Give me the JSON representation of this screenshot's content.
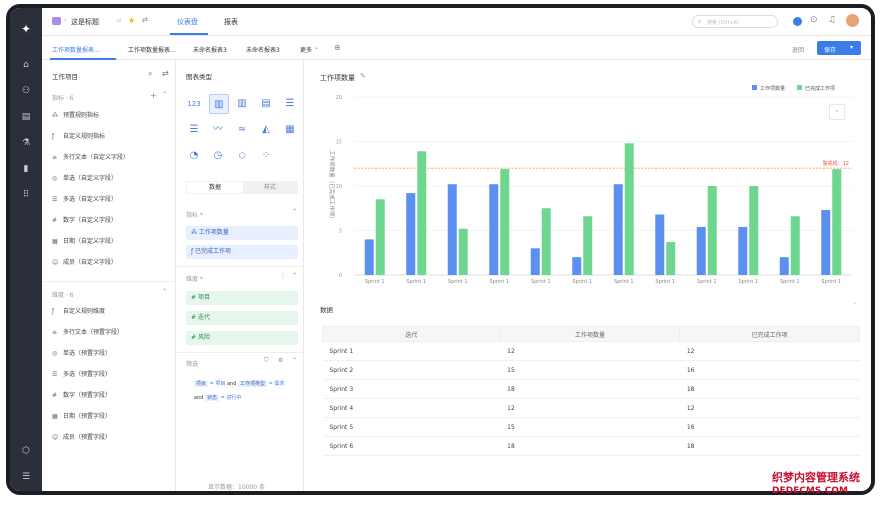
{
  "topbar": {
    "breadcrumb": "这是标题",
    "tabs": [
      "仪表盘",
      "报表"
    ],
    "search_placeholder": "搜索 (Ctrl+K)"
  },
  "report_tabs": {
    "items": [
      "工作项数量报表...",
      "工作项数量报表...",
      "未命名报表3",
      "未命名报表3",
      "更多"
    ],
    "cancel": "退回",
    "save": "保存"
  },
  "fields_panel": {
    "title": "工作项目",
    "metrics_header": "指标 · 6",
    "metrics": [
      "预置规则指标",
      "自定义规则指标",
      "多行文本（自定义字段）",
      "单选（自定义字段）",
      "多选（自定义字段）",
      "数字（自定义字段）",
      "日期（自定义字段）",
      "成员（自定义字段）"
    ],
    "dims_header": "维度 · 6",
    "dims": [
      "自定义规则维度",
      "多行文本（预置字段）",
      "单选（预置字段）",
      "多选（预置字段）",
      "数字（预置字段）",
      "日期（预置字段）",
      "成员（预置字段）"
    ]
  },
  "config_panel": {
    "title": "图表类型",
    "seg_data": "数据",
    "seg_style": "样式",
    "metric_label": "指标 *",
    "metric_chips": [
      "工作项数量",
      "已完成工作项"
    ],
    "dim_label": "维度 *",
    "dim_chips": [
      "项目",
      "迭代",
      "风险"
    ],
    "filter_label": "筛选",
    "filter_row1_a": "项目",
    "filter_row1_eq": "= 项目",
    "filter_row1_and": "and",
    "filter_row1_b": "工作项类型",
    "filter_row1_c": "= 需求",
    "filter_row2_and": "and",
    "filter_row2_a": "状态",
    "filter_row2_b": "= 进行中",
    "footer": "显示数据：10000 条"
  },
  "chart_data": {
    "type": "bar",
    "title": "工作项数量",
    "ylabel": "工作项数量（已完成工作项）",
    "ylim": [
      0,
      20
    ],
    "yticks": [
      0,
      5,
      10,
      15,
      20
    ],
    "categories": [
      "Sprint 1",
      "Sprint 1",
      "Sprint 1",
      "Sprint 1",
      "Sprint 1",
      "Sprint 1",
      "Sprint 1",
      "Sprint 1",
      "Sprint 1",
      "Sprint 1",
      "Sprint 1",
      "Sprint 1"
    ],
    "series": [
      {
        "name": "工作项数量",
        "color": "#5b8ff0",
        "values": [
          4,
          9.2,
          10.2,
          10.2,
          3,
          2,
          10.2,
          6.8,
          5.4,
          5.4,
          2,
          7.3
        ]
      },
      {
        "name": "已完成工作项",
        "color": "#6fd68f",
        "values": [
          8.5,
          13.9,
          5.2,
          11.9,
          7.5,
          6.6,
          14.8,
          3.7,
          10,
          10,
          6.6,
          11.9
        ]
      }
    ],
    "refline": {
      "label": "警戒线：12",
      "value": 12
    },
    "legend": "top-right"
  },
  "data_table": {
    "title": "数据",
    "headers": [
      "迭代",
      "工作项数量",
      "已完成工作项"
    ],
    "rows": [
      [
        "Sprint 1",
        "12",
        "12"
      ],
      [
        "Sprint 2",
        "15",
        "16"
      ],
      [
        "Sprint 3",
        "18",
        "18"
      ],
      [
        "Sprint 4",
        "12",
        "12"
      ],
      [
        "Sprint 5",
        "15",
        "16"
      ],
      [
        "Sprint 6",
        "18",
        "18"
      ]
    ]
  },
  "watermark": {
    "line1": "织梦内容管理系统",
    "line2": "DEDECMS.COM"
  }
}
